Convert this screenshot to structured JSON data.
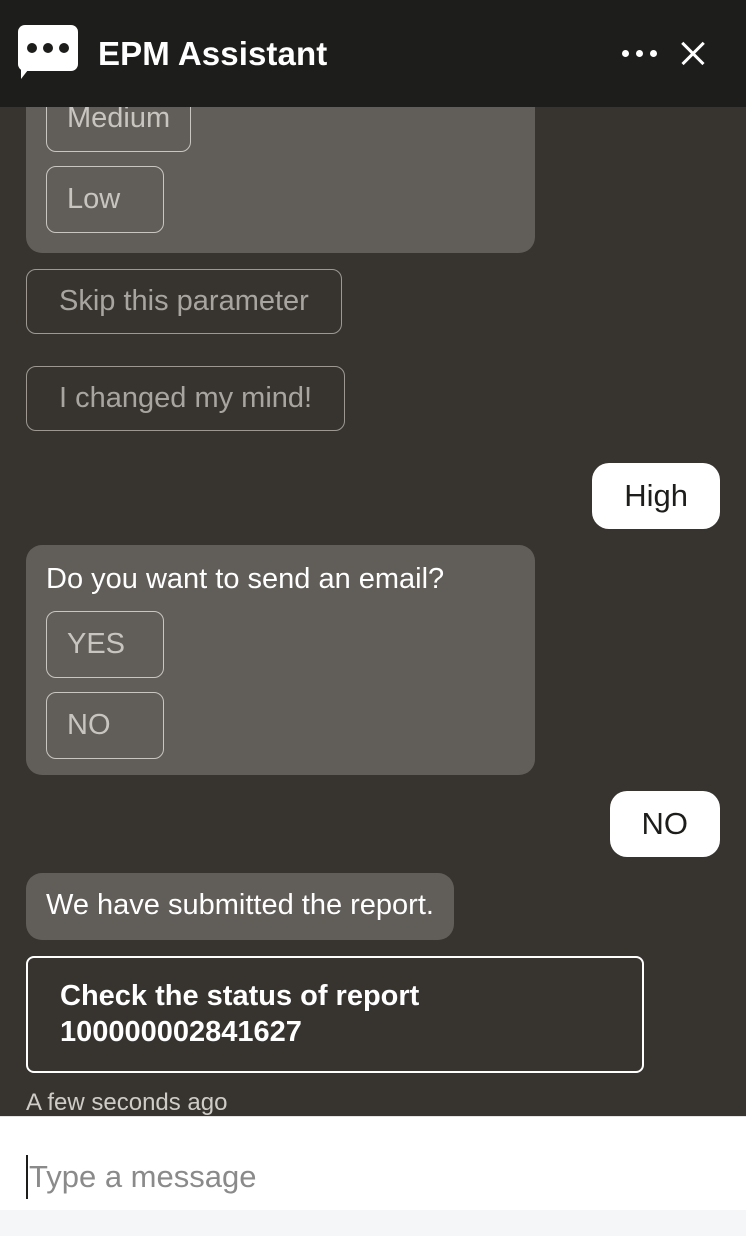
{
  "header": {
    "title": "EPM Assistant",
    "logo_icon": "chat-bubble-dots-icon",
    "menu_icon": "kebab-menu-icon",
    "close_icon": "close-icon"
  },
  "colors": {
    "header_bg": "#1d1d1b",
    "chat_bg": "#373430",
    "bot_bubble": "#615d58",
    "user_bubble": "#ffffff",
    "option_border": "#c9c5c0",
    "emphasis_border": "#ffffff",
    "composer_bg": "#ffffff"
  },
  "conversation": {
    "priority_prompt": {
      "options": [
        "Medium",
        "Low"
      ]
    },
    "standalone_options": [
      "Skip this parameter",
      "I changed my mind!"
    ],
    "user_reply_priority": "High",
    "email_prompt": {
      "question": "Do you want to send an email?",
      "options": [
        "YES",
        "NO"
      ]
    },
    "user_reply_email": "NO",
    "submitted_message": "We have submitted the report.",
    "status_action": "Check the status of report 100000002841627",
    "status_action_line1": "Check the status of report",
    "status_action_line2": "100000002841627",
    "timestamp": "A few seconds ago"
  },
  "composer": {
    "placeholder": "Type a message",
    "value": ""
  }
}
